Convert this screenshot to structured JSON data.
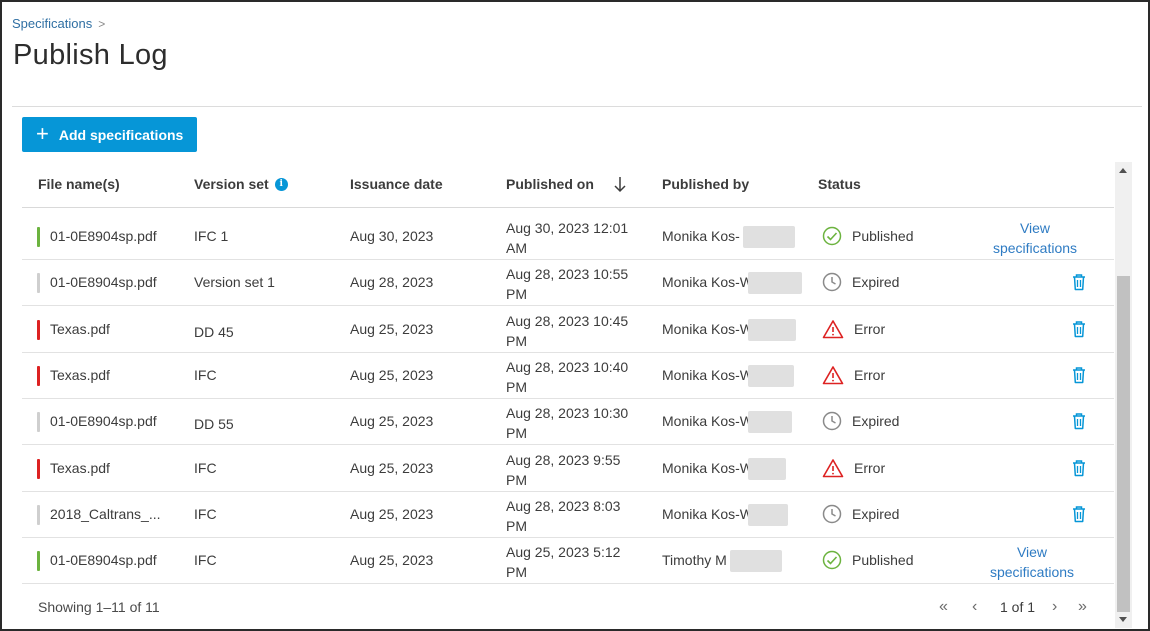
{
  "breadcrumb": {
    "parent": "Specifications",
    "separator": ">"
  },
  "page": {
    "title": "Publish Log"
  },
  "toolbar": {
    "add_label": "Add specifications",
    "add_icon": "plus-icon"
  },
  "table": {
    "columns": {
      "file": "File name(s)",
      "version": "Version set",
      "issuance": "Issuance date",
      "published_on": "Published on",
      "published_by": "Published by",
      "status": "Status"
    },
    "rows": [
      {
        "file": "01-0E8904sp.pdf",
        "version": "IFC 1",
        "issuance": "Aug 30, 2023",
        "published_on_1": "Aug 30, 2023 12:01",
        "published_on_2": "AM",
        "published_by": "Monika Kos-",
        "status": "Published",
        "status_kind": "published",
        "bar_color": "#6cb33f",
        "action": "view",
        "action_line1": "View",
        "action_line2": "specifications"
      },
      {
        "file": "01-0E8904sp.pdf",
        "version": "Version set 1",
        "issuance": "Aug 28, 2023",
        "published_on_1": "Aug 28, 2023 10:55",
        "published_on_2": "PM",
        "published_by": "Monika Kos-W",
        "status": "Expired",
        "status_kind": "expired",
        "bar_color": "#cfcfcf",
        "action": "delete"
      },
      {
        "file": "Texas.pdf",
        "version": "DD 45",
        "issuance": "Aug 25, 2023",
        "published_on_1": "Aug 28, 2023 10:45",
        "published_on_2": "PM",
        "published_by": "Monika Kos-W",
        "status": "Error",
        "status_kind": "error",
        "bar_color": "#dd2222",
        "action": "delete"
      },
      {
        "file": "Texas.pdf",
        "version": "IFC",
        "issuance": "Aug 25, 2023",
        "published_on_1": "Aug 28, 2023 10:40",
        "published_on_2": "PM",
        "published_by": "Monika Kos-W",
        "status": "Error",
        "status_kind": "error",
        "bar_color": "#dd2222",
        "action": "delete"
      },
      {
        "file": "01-0E8904sp.pdf",
        "version": "DD 55",
        "issuance": "Aug 25, 2023",
        "published_on_1": "Aug 28, 2023 10:30",
        "published_on_2": "PM",
        "published_by": "Monika Kos-W",
        "status": "Expired",
        "status_kind": "expired",
        "bar_color": "#cfcfcf",
        "action": "delete"
      },
      {
        "file": "Texas.pdf",
        "version": "IFC",
        "issuance": "Aug 25, 2023",
        "published_on_1": "Aug 28, 2023 9:55",
        "published_on_2": "PM",
        "published_by": "Monika Kos-W",
        "status": "Error",
        "status_kind": "error",
        "bar_color": "#dd2222",
        "action": "delete"
      },
      {
        "file": "2018_Caltrans_...",
        "version": "IFC",
        "issuance": "Aug 25, 2023",
        "published_on_1": "Aug 28, 2023 8:03",
        "published_on_2": "PM",
        "published_by": "Monika Kos-W",
        "status": "Expired",
        "status_kind": "expired",
        "bar_color": "#cfcfcf",
        "action": "delete"
      },
      {
        "file": "01-0E8904sp.pdf",
        "version": "IFC",
        "issuance": "Aug 25, 2023",
        "published_on_1": "Aug 25, 2023 5:12",
        "published_on_2": "PM",
        "published_by": "Timothy M",
        "status": "Published",
        "status_kind": "published",
        "bar_color": "#6cb33f",
        "action": "view",
        "action_line1": "View",
        "action_line2": "specifications"
      }
    ]
  },
  "footer": {
    "showing": "Showing 1–11 of 11",
    "page_label": "1 of 1",
    "first_icon": "«",
    "prev_icon": "‹",
    "next_icon": "›",
    "last_icon": "»"
  },
  "colors": {
    "accent": "#0696d7",
    "link": "#2e7bc3",
    "published": "#6cb33f",
    "error": "#dd2222",
    "expired": "#8a8a8a"
  }
}
